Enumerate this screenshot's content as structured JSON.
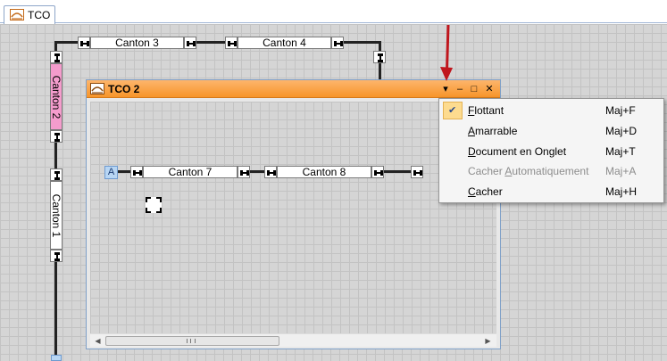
{
  "tabs": [
    {
      "label": "TCO",
      "icon": "tco-panel-icon"
    }
  ],
  "main_panel": {
    "cantons": [
      {
        "label": "Canton 3",
        "orientation": "horizontal"
      },
      {
        "label": "Canton 4",
        "orientation": "horizontal"
      },
      {
        "label": "Canton 2",
        "orientation": "vertical",
        "color": "#f49ccc"
      },
      {
        "label": "Canton 1",
        "orientation": "vertical"
      }
    ]
  },
  "floating_window": {
    "title": "TCO 2",
    "icon": "tco-panel-icon",
    "title_color": "#f7952a",
    "buttons": [
      {
        "name": "dropdown",
        "glyph": "▾"
      },
      {
        "name": "minimize",
        "glyph": "–"
      },
      {
        "name": "maximize",
        "glyph": "□"
      },
      {
        "name": "close",
        "glyph": "✕"
      }
    ],
    "a_button": "A",
    "cantons": [
      {
        "label": "Canton 7"
      },
      {
        "label": "Canton 8"
      }
    ],
    "scroll_left": "◀",
    "scroll_right": "▶"
  },
  "context_menu": {
    "items": [
      {
        "pre": "",
        "ul": "F",
        "post": "lottant",
        "shortcut": "Maj+F",
        "checked": true,
        "disabled": false
      },
      {
        "pre": "",
        "ul": "A",
        "post": "marrable",
        "shortcut": "Maj+D",
        "checked": false,
        "disabled": false
      },
      {
        "pre": "",
        "ul": "D",
        "post": "ocument en Onglet",
        "shortcut": "Maj+T",
        "checked": false,
        "disabled": false
      },
      {
        "pre": "Cacher ",
        "ul": "A",
        "post": "utomatiquement",
        "shortcut": "Maj+A",
        "checked": false,
        "disabled": true
      },
      {
        "pre": "",
        "ul": "C",
        "post": "acher",
        "shortcut": "Maj+H",
        "checked": false,
        "disabled": false
      }
    ],
    "check_glyph": "✔"
  },
  "colors": {
    "annotation_arrow": "#c0161d",
    "menu_check_highlight": "#fddb8f"
  }
}
